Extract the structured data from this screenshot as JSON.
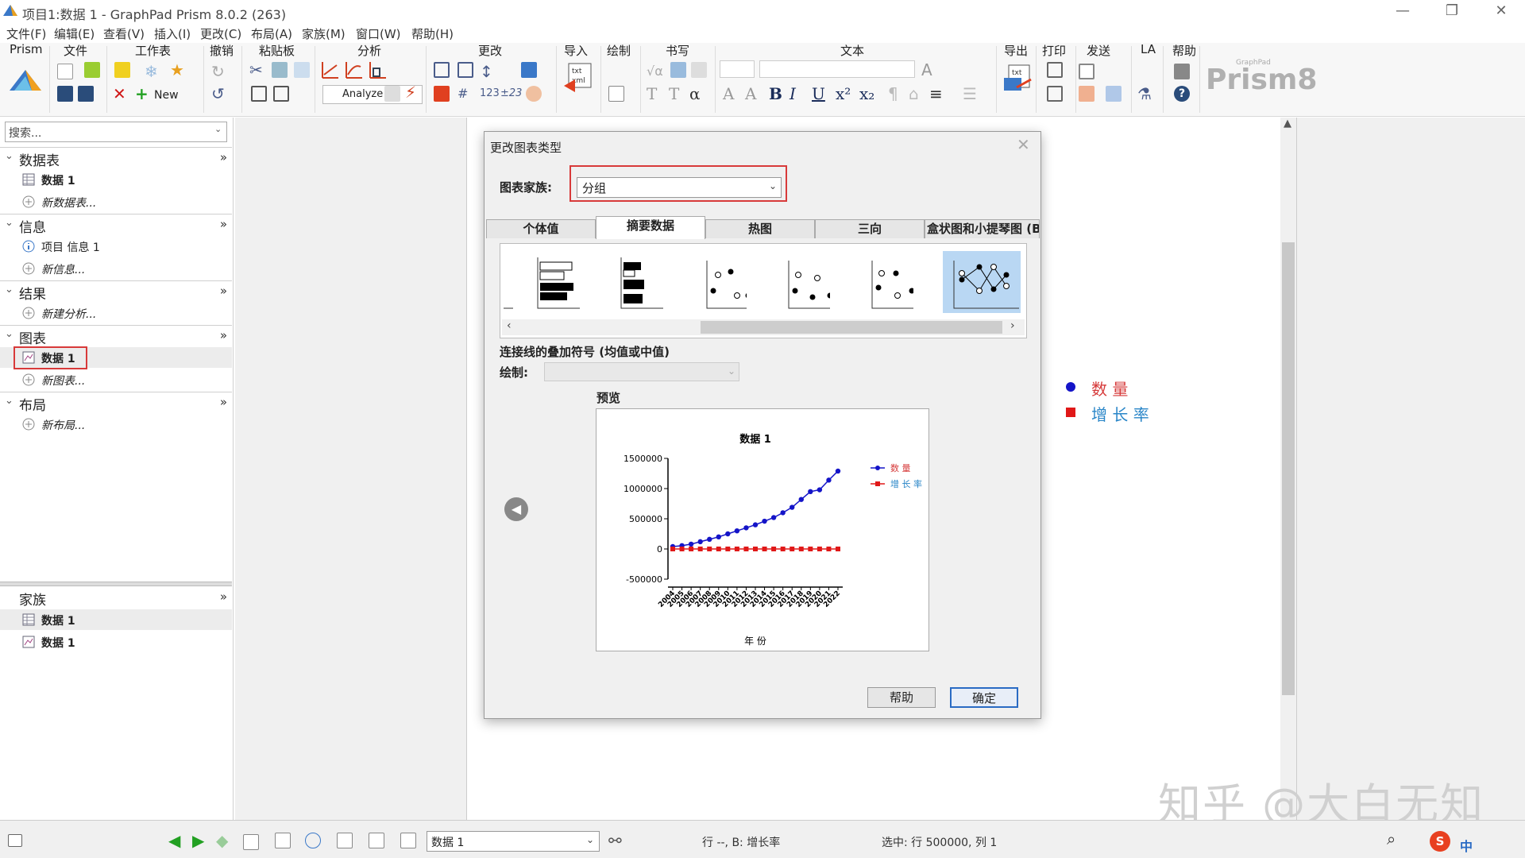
{
  "window": {
    "title": "项目1:数据 1 - GraphPad Prism 8.0.2 (263)"
  },
  "menu": [
    "文件(F)",
    "编辑(E)",
    "查看(V)",
    "插入(I)",
    "更改(C)",
    "布局(A)",
    "家族(M)",
    "窗口(W)",
    "帮助(H)"
  ],
  "ribbon": {
    "groups": [
      "Prism",
      "文件",
      "工作表",
      "撤销",
      "粘贴板",
      "分析",
      "更改",
      "导入",
      "绘制",
      "书写",
      "文本",
      "导出",
      "打印",
      "发送",
      "LA",
      "帮助"
    ],
    "new_label": "New",
    "analyze_label": "Analyze",
    "brand": "Prism8",
    "brand_small": "GraphPad"
  },
  "sidebar": {
    "search_placeholder": "搜索...",
    "sections": [
      {
        "label": "数据表",
        "items": [
          {
            "label": "数据 1",
            "bold": true
          },
          {
            "label": "新数据表...",
            "italic": true
          }
        ]
      },
      {
        "label": "信息",
        "items": [
          {
            "label": "项目 信息 1"
          },
          {
            "label": "新信息...",
            "italic": true
          }
        ]
      },
      {
        "label": "结果",
        "items": [
          {
            "label": "新建分析...",
            "italic": true
          }
        ]
      },
      {
        "label": "图表",
        "items": [
          {
            "label": "数据 1",
            "bold": true
          },
          {
            "label": "新图表...",
            "italic": true
          }
        ]
      },
      {
        "label": "布局",
        "items": [
          {
            "label": "新布局...",
            "italic": true
          }
        ]
      }
    ],
    "family": {
      "label": "家族",
      "items": [
        "数据 1",
        "数据 1"
      ]
    }
  },
  "dialog": {
    "title": "更改图表类型",
    "family_label": "图表家族:",
    "family_value": "分组",
    "tabs": [
      "个体值",
      "摘要数据",
      "热图",
      "三向",
      "盒状图和小提琴图 (B"
    ],
    "active_tab": 1,
    "overlay_label": "连接线的叠加符号 (均值或中值)",
    "plot_label": "绘制:",
    "preview_label": "预览",
    "help_button": "帮助",
    "ok_button": "确定"
  },
  "chart_data": {
    "type": "line",
    "title": "数据 1",
    "xlabel": "年 份",
    "ylabel": "",
    "ylim": [
      -500000,
      1500000
    ],
    "yticks": [
      "1500000",
      "1000000",
      "500000",
      "0",
      "-500000"
    ],
    "categories": [
      "2004",
      "2005",
      "2006",
      "2007",
      "2008",
      "2009",
      "2010",
      "2011",
      "2012",
      "2013",
      "2014",
      "2015",
      "2016",
      "2017",
      "2018",
      "2019",
      "2020",
      "2021",
      "2022"
    ],
    "series": [
      {
        "name": "数 量",
        "color": "#1414c8",
        "marker": "circle",
        "values": [
          40000,
          55000,
          80000,
          120000,
          160000,
          200000,
          250000,
          300000,
          350000,
          400000,
          460000,
          520000,
          600000,
          690000,
          820000,
          950000,
          980000,
          1140000,
          1290000
        ]
      },
      {
        "name": "增 长 率",
        "color": "#e01818",
        "marker": "square",
        "values": [
          0,
          0,
          0,
          0,
          0,
          0,
          0,
          0,
          0,
          0,
          0,
          0,
          0,
          0,
          0,
          0,
          0,
          0,
          0
        ]
      }
    ]
  },
  "main_legend": [
    {
      "label": "数 量",
      "color": "#d63a3a",
      "marker_color": "#1414c8"
    },
    {
      "label": "增 长 率",
      "color": "#2a86c8",
      "marker_color": "#e01818"
    }
  ],
  "statusbar": {
    "sheet": "数据 1",
    "row_info": "行 --, B: 增长率",
    "selection": "选中: 行 500000, 列 1",
    "ime": "中"
  },
  "watermark": "知乎 @大白无知"
}
